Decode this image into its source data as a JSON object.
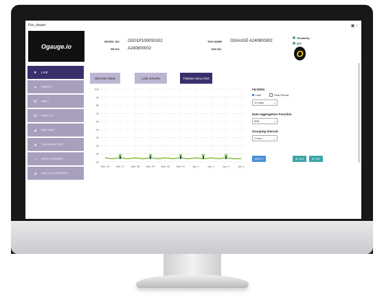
{
  "window": {
    "title": "Fire_depart"
  },
  "header": {
    "logo_text": "Ogauge.io",
    "model_label": "MODEL NO.",
    "model_value": "OG01P1000S0102",
    "sr_label": "SR NO.",
    "sr_value": "A240800002",
    "tag_name_label": "TAG NAME",
    "tag_name_value": "OGAUGE A240800002",
    "tag_no_label": "TAG NO.",
    "status_telemetry": "Telemetry",
    "status_iot": "IOT",
    "status_color": "#3bb36a"
  },
  "sidebar": {
    "items": [
      {
        "label": "LIVE",
        "icon": "star-icon"
      },
      {
        "label": "ABOUT",
        "icon": "info-icon"
      },
      {
        "label": "MIDA",
        "icon": "document-icon"
      },
      {
        "label": "SWITCH",
        "icon": "switch-icon"
      },
      {
        "label": "SECTOR",
        "icon": "sector-icon"
      },
      {
        "label": "TRANSMITTER",
        "icon": "transmitter-icon"
      },
      {
        "label": "DATA LOGGER",
        "icon": "logger-icon"
      },
      {
        "label": "HELP & SUPPORT",
        "icon": "help-icon"
      }
    ]
  },
  "tabs": [
    {
      "label": "DEVICE VIEW"
    },
    {
      "label": "LIVE GRAPH"
    },
    {
      "label": "TREND ANALYSIS"
    }
  ],
  "filters": {
    "title": "FILTERS",
    "radio_last": "Last",
    "radio_time_period": "Time Period",
    "last_select": "10 days",
    "aggregation_label": "Data Aggregation Function",
    "aggregation_select": "MIN",
    "grouping_label": "Grouping Interval",
    "grouping_select": "1 hour",
    "apply_label": "APPLY",
    "csv_label": "CSV",
    "pdf_label": "PDF"
  },
  "colors": {
    "accent": "#3b2f6b",
    "light_accent": "#bdb5d1",
    "button_blue": "#4a8fd8",
    "button_teal": "#3aa6a8",
    "series": "#8bc34a"
  },
  "chart_data": {
    "type": "line",
    "x": [
      "Mar 26",
      "Mar 27",
      "Mar 28",
      "Mar 29",
      "Mar 30",
      "Mar 31",
      "Apr 1",
      "Apr 2",
      "Apr 3",
      "Apr 4"
    ],
    "yticks": [
      10,
      20,
      30,
      40,
      50,
      60,
      70,
      80,
      90,
      100
    ],
    "ylim": [
      10,
      100
    ],
    "grid": true,
    "series": [
      {
        "values": [
          15,
          14,
          15,
          14,
          15,
          14,
          15,
          14,
          15,
          14,
          15,
          14,
          15,
          14,
          15,
          14,
          15,
          14,
          14
        ]
      }
    ],
    "markers": [
      {
        "x_index": 1.0,
        "y": 18
      },
      {
        "x_index": 3.0,
        "y": 18
      },
      {
        "x_index": 5.0,
        "y": 18
      },
      {
        "x_index": 6.5,
        "y": 18
      },
      {
        "x_index": 8.0,
        "y": 18
      }
    ]
  }
}
